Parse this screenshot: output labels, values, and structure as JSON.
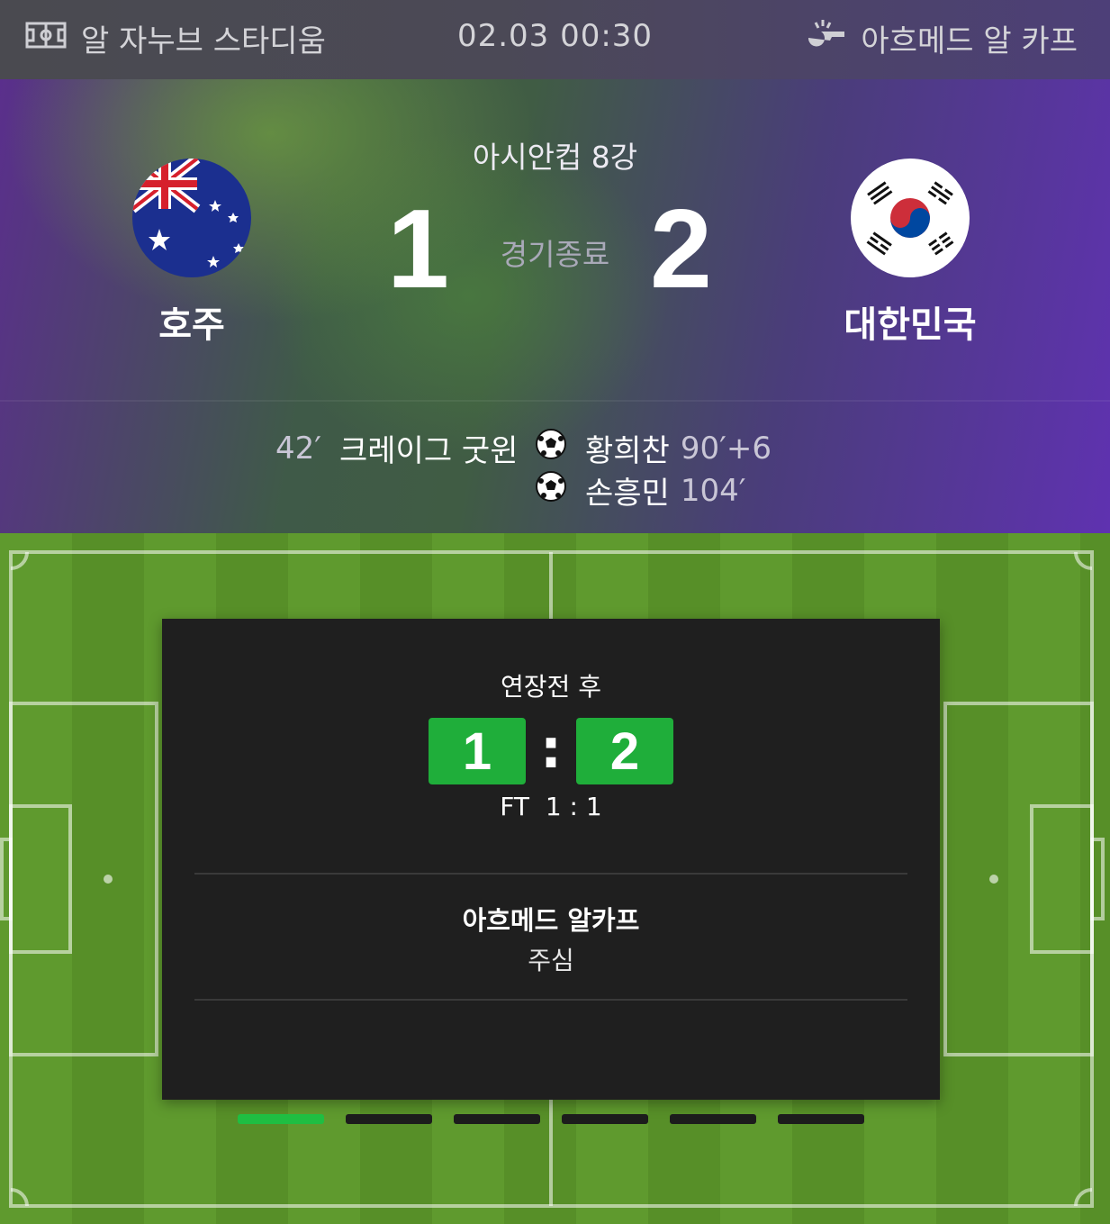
{
  "header": {
    "venue": "알 자누브 스타디움",
    "datetime": "02.03 00:30",
    "referee": "아흐메드 알 카프",
    "venue_icon": "stadium-icon",
    "referee_icon": "whistle-icon"
  },
  "match": {
    "competition": "아시안컵 8강",
    "status": "경기종료",
    "home": {
      "name": "호주",
      "score": "1",
      "flag_icon": "australia-flag-icon"
    },
    "away": {
      "name": "대한민국",
      "score": "2",
      "flag_icon": "south-korea-flag-icon"
    },
    "goals": {
      "home": [
        {
          "minute": "42′",
          "scorer": "크레이그 굿윈"
        }
      ],
      "away": [
        {
          "scorer": "황희찬",
          "minute": "90′+6"
        },
        {
          "scorer": "손흥민",
          "minute": "104′"
        }
      ]
    }
  },
  "card": {
    "period": "연장전 후",
    "home_score": "1",
    "separator": ":",
    "away_score": "2",
    "fulltime": "FT  1 : 1",
    "referee_name": "아흐메드 알카프",
    "referee_role": "주심"
  },
  "pager": {
    "count": 6,
    "active_index": 0
  },
  "colors": {
    "accent_green": "#1fae3a",
    "pager_active": "#1fbe42",
    "card_bg": "#1f1f1f"
  }
}
